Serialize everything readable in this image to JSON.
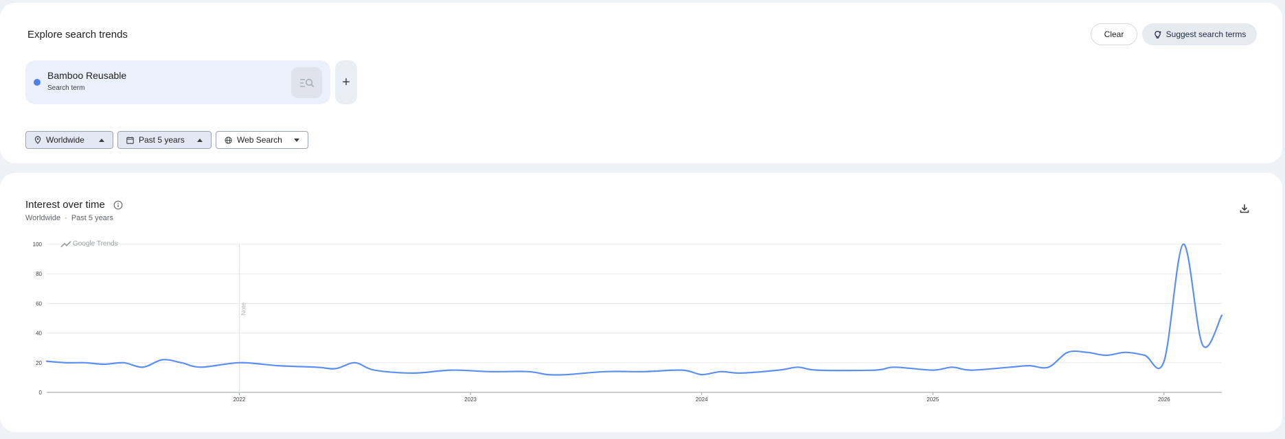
{
  "header": {
    "title": "Explore search trends",
    "clear_label": "Clear",
    "suggest_label": "Suggest search terms"
  },
  "search_term": {
    "name": "Bamboo Reusable",
    "type": "Search term",
    "color": "#4f7ee6"
  },
  "add_term": {
    "label": "+"
  },
  "filters": {
    "geo": "Worldwide",
    "time": "Past 5 years",
    "property": "Web Search"
  },
  "interest_over_time": {
    "title": "Interest over time",
    "subtitle_geo": "Worldwide",
    "subtitle_sep": "·",
    "subtitle_time": "Past 5 years",
    "watermark": "Google Trends",
    "note_label": "Note"
  },
  "chart_data": {
    "type": "line",
    "series": [
      {
        "name": "Bamboo Reusable",
        "color": "#5b8ff0"
      }
    ],
    "ylim": [
      0,
      100
    ],
    "yticks": [
      "100",
      "80",
      "60",
      "40",
      "20",
      "0"
    ],
    "xticks": [
      "2022",
      "2023",
      "2024",
      "2025",
      "2026"
    ],
    "points": [
      [
        "2021-03",
        21
      ],
      [
        "2021-04",
        20
      ],
      [
        "2021-05",
        20
      ],
      [
        "2021-06",
        19
      ],
      [
        "2021-07",
        20
      ],
      [
        "2021-08",
        17
      ],
      [
        "2021-09",
        22
      ],
      [
        "2021-10",
        20
      ],
      [
        "2021-11",
        17
      ],
      [
        "2022-01",
        20
      ],
      [
        "2022-03",
        18
      ],
      [
        "2022-05",
        17
      ],
      [
        "2022-06",
        16
      ],
      [
        "2022-07",
        20
      ],
      [
        "2022-08",
        15
      ],
      [
        "2022-10",
        13
      ],
      [
        "2022-12",
        15
      ],
      [
        "2023-02",
        14
      ],
      [
        "2023-04",
        14
      ],
      [
        "2023-05",
        12
      ],
      [
        "2023-06",
        12
      ],
      [
        "2023-08",
        14
      ],
      [
        "2023-10",
        14
      ],
      [
        "2023-12",
        15
      ],
      [
        "2024-01",
        12
      ],
      [
        "2024-02",
        14
      ],
      [
        "2024-03",
        13
      ],
      [
        "2024-05",
        15
      ],
      [
        "2024-06",
        17
      ],
      [
        "2024-07",
        15
      ],
      [
        "2024-10",
        15
      ],
      [
        "2024-11",
        17
      ],
      [
        "2025-01",
        15
      ],
      [
        "2025-02",
        17
      ],
      [
        "2025-03",
        15
      ],
      [
        "2025-05",
        17
      ],
      [
        "2025-06",
        18
      ],
      [
        "2025-07",
        17
      ],
      [
        "2025-08",
        27
      ],
      [
        "2025-09",
        27
      ],
      [
        "2025-10",
        25
      ],
      [
        "2025-11",
        27
      ],
      [
        "2025-12",
        25
      ],
      [
        "2026-01",
        21
      ],
      [
        "2026-02",
        100
      ],
      [
        "2026-03",
        32
      ],
      [
        "2026-04",
        52
      ]
    ]
  }
}
